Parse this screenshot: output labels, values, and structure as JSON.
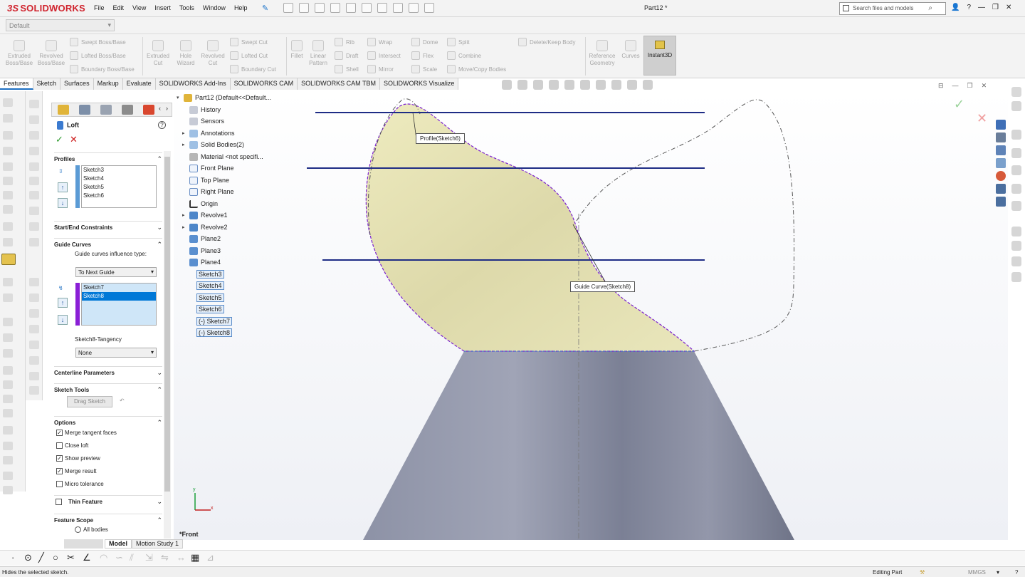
{
  "app": {
    "brand": "SOLIDWORKS",
    "document_title": "Part12 *",
    "menu": [
      "File",
      "Edit",
      "View",
      "Insert",
      "Tools",
      "Window",
      "Help"
    ],
    "search_placeholder": "Search files and models"
  },
  "config": {
    "selected": "Default"
  },
  "ribbon": {
    "large": [
      {
        "label": "Extruded Boss/Base"
      },
      {
        "label": "Revolved Boss/Base"
      },
      {
        "label": "Extruded Cut"
      },
      {
        "label": "Hole Wizard"
      },
      {
        "label": "Revolved Cut"
      },
      {
        "label": "Fillet"
      },
      {
        "label": "Linear Pattern"
      },
      {
        "label": "Reference Geometry"
      },
      {
        "label": "Curves"
      },
      {
        "label": "Instant3D"
      }
    ],
    "small": [
      "Swept Boss/Base",
      "Lofted Boss/Base",
      "Boundary Boss/Base",
      "Swept Cut",
      "Lofted Cut",
      "Boundary Cut",
      "Rib",
      "Draft",
      "Shell",
      "Wrap",
      "Intersect",
      "Mirror",
      "Dome",
      "Flex",
      "Scale",
      "Split",
      "Combine",
      "Move/Copy Bodies",
      "Delete/Keep Body"
    ]
  },
  "tabs": [
    "Features",
    "Sketch",
    "Surfaces",
    "Markup",
    "Evaluate",
    "SOLIDWORKS Add-Ins",
    "SOLIDWORKS CAM",
    "SOLIDWORKS CAM TBM",
    "SOLIDWORKS Visualize"
  ],
  "pm": {
    "title": "Loft",
    "profiles_header": "Profiles",
    "profiles": [
      "Sketch3",
      "Sketch4",
      "Sketch5",
      "Sketch6"
    ],
    "start_end_header": "Start/End Constraints",
    "guide_header": "Guide Curves",
    "guide_influence_label": "Guide curves influence type:",
    "guide_influence_value": "To Next Guide",
    "guides": [
      "Sketch7",
      "Sketch8"
    ],
    "tangency_label": "Sketch8-Tangency",
    "tangency_value": "None",
    "centerline_header": "Centerline Parameters",
    "sketch_tools_header": "Sketch Tools",
    "drag_sketch": "Drag Sketch",
    "options_header": "Options",
    "options": [
      {
        "label": "Merge tangent faces",
        "checked": true
      },
      {
        "label": "Close loft",
        "checked": false
      },
      {
        "label": "Show preview",
        "checked": true
      },
      {
        "label": "Merge result",
        "checked": true
      },
      {
        "label": "Micro tolerance",
        "checked": false
      }
    ],
    "thin_feature": "Thin Feature",
    "scope_header": "Feature Scope",
    "scope_option": "All bodies"
  },
  "tree": {
    "root": "Part12  (Default<<Default...",
    "items": [
      "History",
      "Sensors",
      "Annotations",
      "Solid Bodies(2)",
      "Material <not specifi...",
      "Front Plane",
      "Top Plane",
      "Right Plane",
      "Origin",
      "Revolve1",
      "Revolve2",
      "Plane2",
      "Plane3",
      "Plane4",
      "Sketch3",
      "Sketch4",
      "Sketch5",
      "Sketch6",
      "(-) Sketch7",
      "(-) Sketch8"
    ]
  },
  "graphics": {
    "callout_profile": "Profile(Sketch6)",
    "callout_guide": "Guide Curve(Sketch8)",
    "view_label": "*Front",
    "triad_x": "x",
    "triad_y": "y"
  },
  "bottom": {
    "tabs": [
      "Model",
      "Motion Study 1"
    ]
  },
  "status": {
    "message": "Hides the selected sketch.",
    "mode": "Editing Part",
    "units": "MMGS"
  },
  "colors": {
    "accent": "#1d6fc2",
    "loft_fill": "#e6e3b8",
    "sketch_purple": "#7a1fcf",
    "plane_line": "#1e2c85",
    "cone": "#8a8ea2"
  }
}
